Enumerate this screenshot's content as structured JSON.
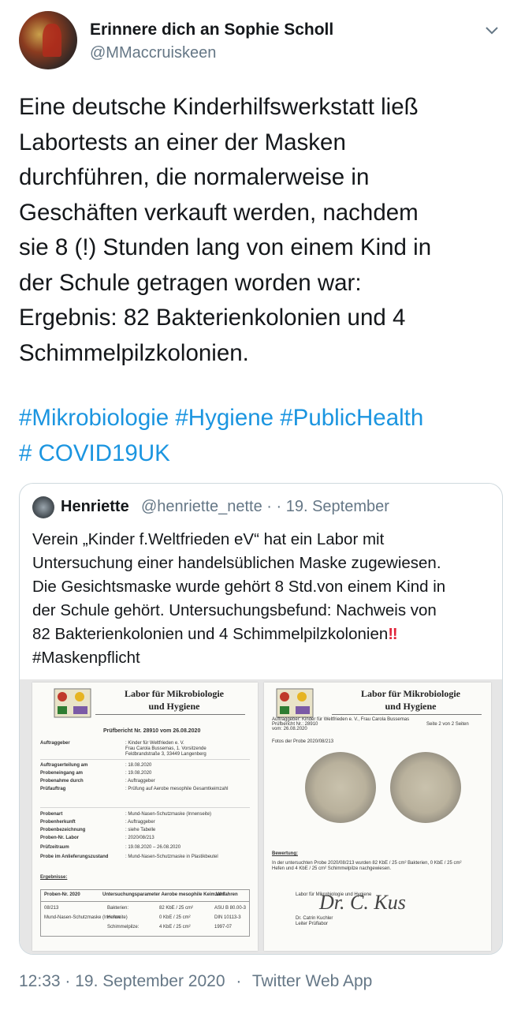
{
  "tweet": {
    "display_name": "Erinnere dich an Sophie Scholl",
    "handle": "@MMaccruiskeen",
    "text_lines": [
      "Eine deutsche Kinderhilfswerkstatt ließ",
      "Labortests an einer der Masken",
      "durchführen, die normalerweise in",
      "Geschäften verkauft werden, nachdem",
      "sie 8 (!) Stunden lang von einem Kind in",
      "der Schule getragen worden war:",
      "Ergebnis: 82 Bakterienkolonien und 4",
      "Schimmelpilzkolonien."
    ],
    "hashtag_lines": [
      "#Mikrobiologie #Hygiene #PublicHealth",
      "# COVID19UK"
    ],
    "timestamp": "12:33 · 19. September 2020",
    "separator": "·",
    "source": "Twitter Web App"
  },
  "quoted": {
    "name": "Henriette",
    "handle_date": "@henriette_nette · · 19. September",
    "text_lines": [
      "Verein „Kinder f.Weltfrieden eV“ hat ein Labor mit",
      "Untersuchung einer handelsüblichen Maske zugewiesen.",
      "Die Gesichtsmaske wurde gehört 8 Std.von einem Kind in",
      "der Schule gehört. Untersuchungsbefund: Nachweis von"
    ],
    "text_line5": "82 Bakterienkolonien und 4 Schimmelpilzkolonien",
    "exclamation": "‼",
    "text_line6": "#Maskenpflicht",
    "doc_left": {
      "lab_title_1": "Labor für Mikrobiologie",
      "lab_title_2": "und Hygiene",
      "report_title": "Prüfbericht Nr. 28910 vom 26.08.2020",
      "rows": [
        [
          "Auftraggeber",
          ": Kinder für Weltfrieden e. V."
        ],
        [
          "",
          "Frau Carola Bussemas, 1. Vorsitzende"
        ],
        [
          "",
          "Feldbrandstraße 3, 33449 Langenberg"
        ],
        [
          "Auftragserteilung am",
          ": 18.08.2020"
        ],
        [
          "Probeneingang am",
          ": 19.08.2020"
        ],
        [
          "Probenahme durch",
          ": Auftraggeber"
        ],
        [
          "Prüfauftrag",
          ": Prüfung auf Aerobe mesophile Gesamtkeimzahl"
        ],
        [
          "Probenart",
          ": Mund-Nasen-Schutzmaske (Innenseite)"
        ],
        [
          "Probenherkunft",
          ": Auftraggeber"
        ],
        [
          "Probenbezeichnung",
          ": siehe Tabelle"
        ],
        [
          "Proben-Nr. Labor",
          ": 2020/08/213"
        ],
        [
          "Prüfzeitraum",
          ": 19.08.2020 – 26.08.2020"
        ],
        [
          "Probe im Anlieferungszustand",
          ": Mund-Nasen-Schutzmaske in Plastikbeutel"
        ]
      ],
      "results_label": "Ergebnisse:",
      "table_headers": [
        "Proben-Nr. 2020",
        "Untersuchungsparameter Aerobe mesophile Keimzahl",
        "Verfahren"
      ],
      "table_rows": [
        [
          "08/213",
          "Bakterien:",
          "82 KbE / 25 cm²",
          "ASU B 80.00-3"
        ],
        [
          "Mund-Nasen-Schutzmaske (Innenseite)",
          "Hefen:",
          "0 KbE / 25 cm²",
          "DIN 10113-3"
        ],
        [
          "",
          "Schimmelpilze:",
          "4 KbE / 25 cm²",
          "1997-07"
        ]
      ]
    },
    "doc_right": {
      "lab_title_1": "Labor für Mikrobiologie",
      "lab_title_2": "und Hygiene",
      "client_line": "Auftraggeber: Kinder für Weltfrieden e. V., Frau Carola Bussemas",
      "report_line": "Prüfbericht Nr.: 28910",
      "page_line": "Seite 2 von 2 Seiten",
      "date_line": "vom: 26.08.2020",
      "photo_label": "Fotos der Probe 2020/08/213",
      "assessment_label": "Bewertung:",
      "assessment_text_1": "In der untersuchten Probe 2020/08/213 wurden 82 KbE / 25 cm² Bakterien, 0 KbE / 25 cm²",
      "assessment_text_2": "Hefen und 4 KbE / 25 cm² Schimmelpilze nachgewiesen.",
      "lab_sign": "Labor für Mikrobiologie und Hygiene",
      "signature": "Dr. C. Kus",
      "signer_name": "Dr. Catrin Kuchler",
      "signer_role": "Leiter Prüflabor"
    }
  },
  "colors": {
    "text": "#14171a",
    "secondary": "#657786",
    "link": "#1b95e0",
    "border": "#cfd9de",
    "exclamation": "#e0243a"
  },
  "icons": {
    "chevron": "chevron-down-icon"
  }
}
